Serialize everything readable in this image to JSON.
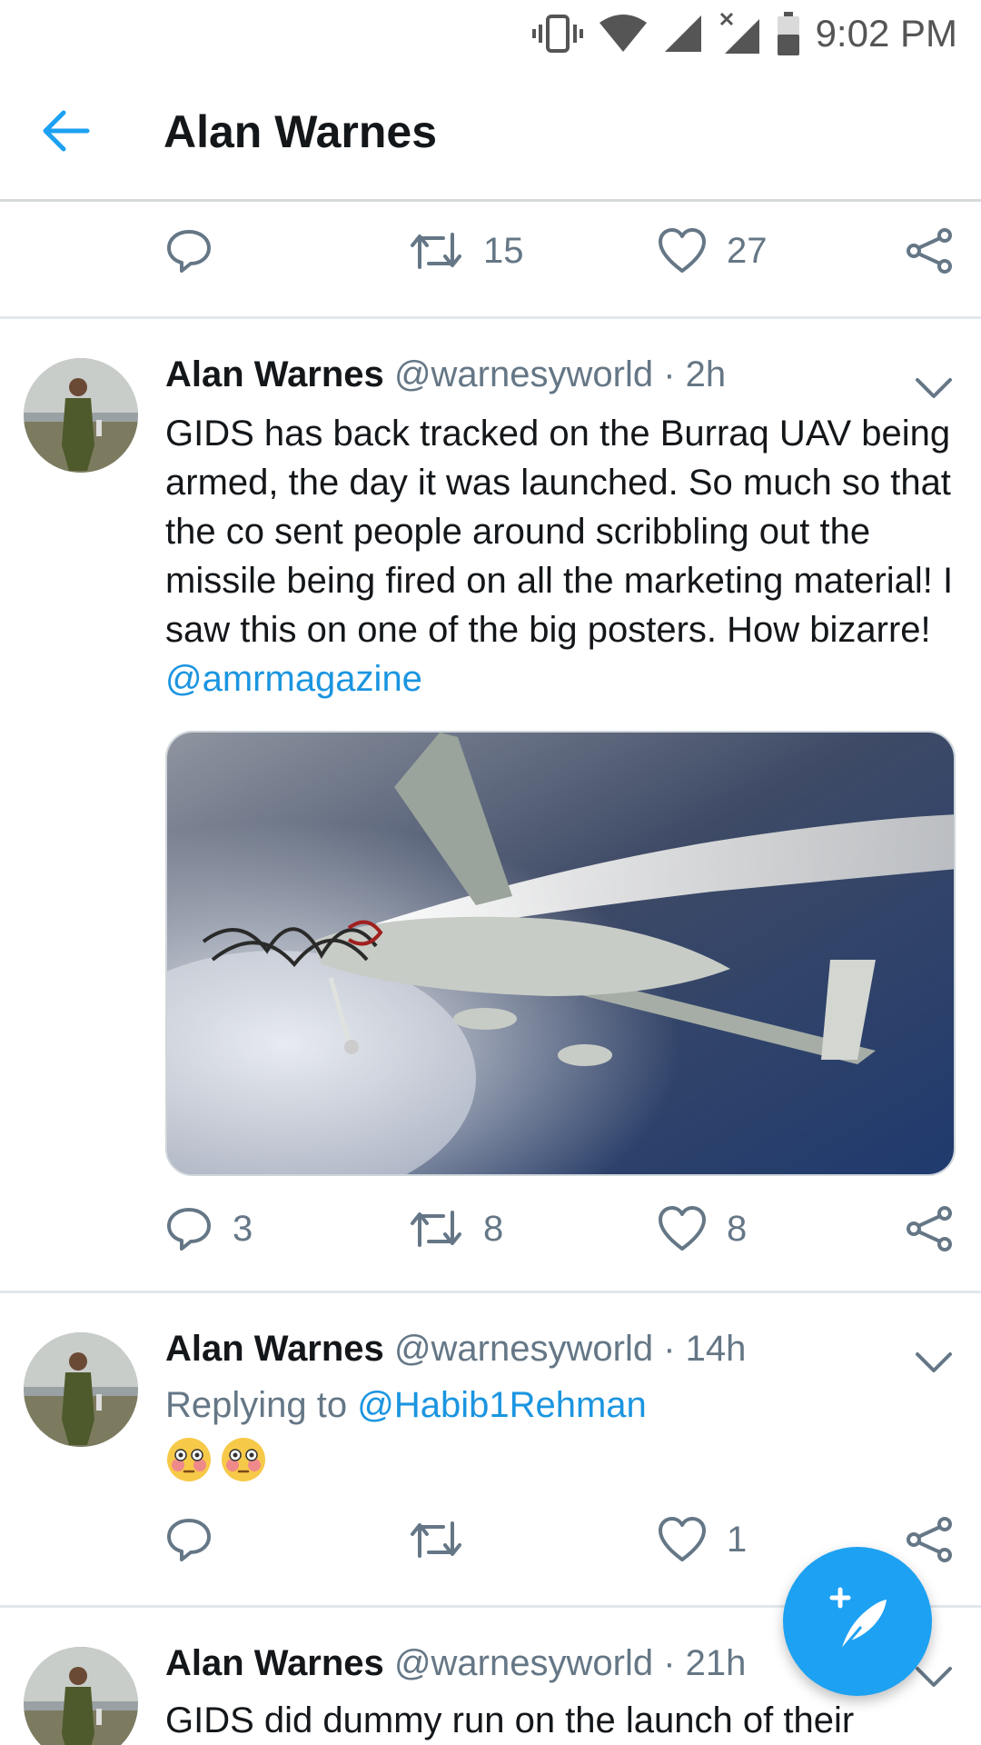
{
  "status_bar": {
    "time": "9:02 PM",
    "icons": [
      "vibrate-icon",
      "wifi-icon",
      "signal-icon",
      "signal-off-icon",
      "battery-icon"
    ]
  },
  "header": {
    "title": "Alan Warnes",
    "back_icon": "arrow-left-icon"
  },
  "top_actions": {
    "reply_count": "",
    "retweet_count": "15",
    "like_count": "27"
  },
  "tweets": [
    {
      "name": "Alan Warnes",
      "meta": "@warnesyworld · 2h",
      "text": "GIDS has back tracked on the Burraq UAV being armed, the day it was launched. So much so that the co sent people around scribbling out the missile being fired on all the marketing material! I saw this on one of the big posters. How bizarre! ",
      "mention": "@amrmagazine",
      "actions": {
        "reply_count": "3",
        "retweet_count": "8",
        "like_count": "8"
      }
    },
    {
      "name": "Alan Warnes",
      "meta": "@warnesyworld · 14h",
      "reply_prefix": "Replying to ",
      "reply_handle": "@Habib1Rehman",
      "emoji": [
        "flushed-face-emoji",
        "flushed-face-emoji"
      ],
      "actions": {
        "reply_count": "",
        "retweet_count": "",
        "like_count": "1"
      }
    },
    {
      "name": "Alan Warnes",
      "meta": "@warnesyworld · 21h",
      "text": "GIDS did dummy run on the launch of their"
    }
  ],
  "colors": {
    "accent": "#1da1f2",
    "link": "#1b95e0",
    "muted": "#657786",
    "text": "#14171a"
  }
}
